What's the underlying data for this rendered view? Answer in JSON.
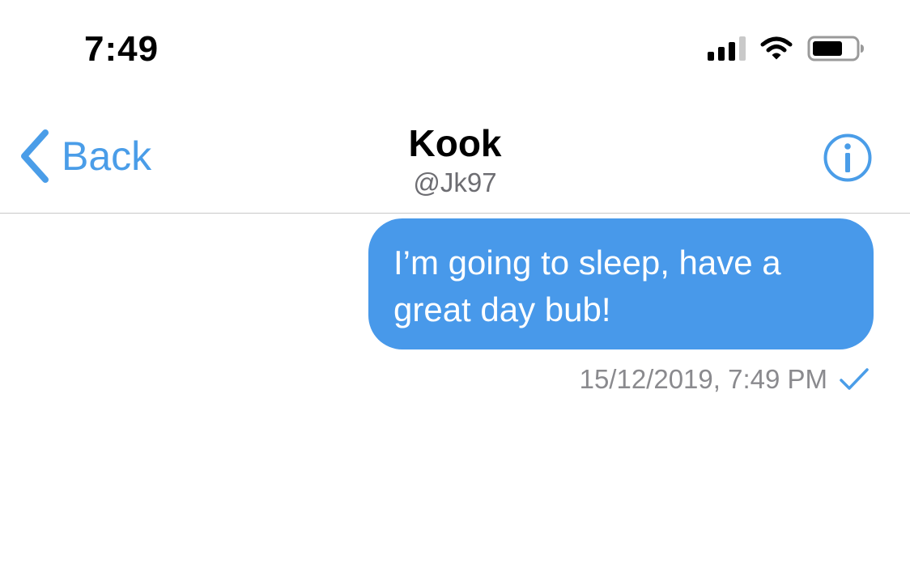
{
  "status_bar": {
    "time": "7:49",
    "icons": [
      "cellular-signal-icon",
      "wifi-icon",
      "battery-icon"
    ]
  },
  "nav": {
    "back_label": "Back",
    "contact_name": "Kook",
    "contact_handle": "@Jk97",
    "info_icon": "info-icon"
  },
  "messages": [
    {
      "direction": "outgoing",
      "text": "I’m going to sleep, have a great day bub!",
      "timestamp": "15/12/2019, 7:49 PM",
      "status_icon": "checkmark-icon"
    }
  ],
  "colors": {
    "accent": "#4a9de8",
    "bubble": "#4899ea",
    "bubble_text": "#ffffff",
    "meta_text": "#8a8a8e",
    "divider": "#c8c8c8"
  }
}
